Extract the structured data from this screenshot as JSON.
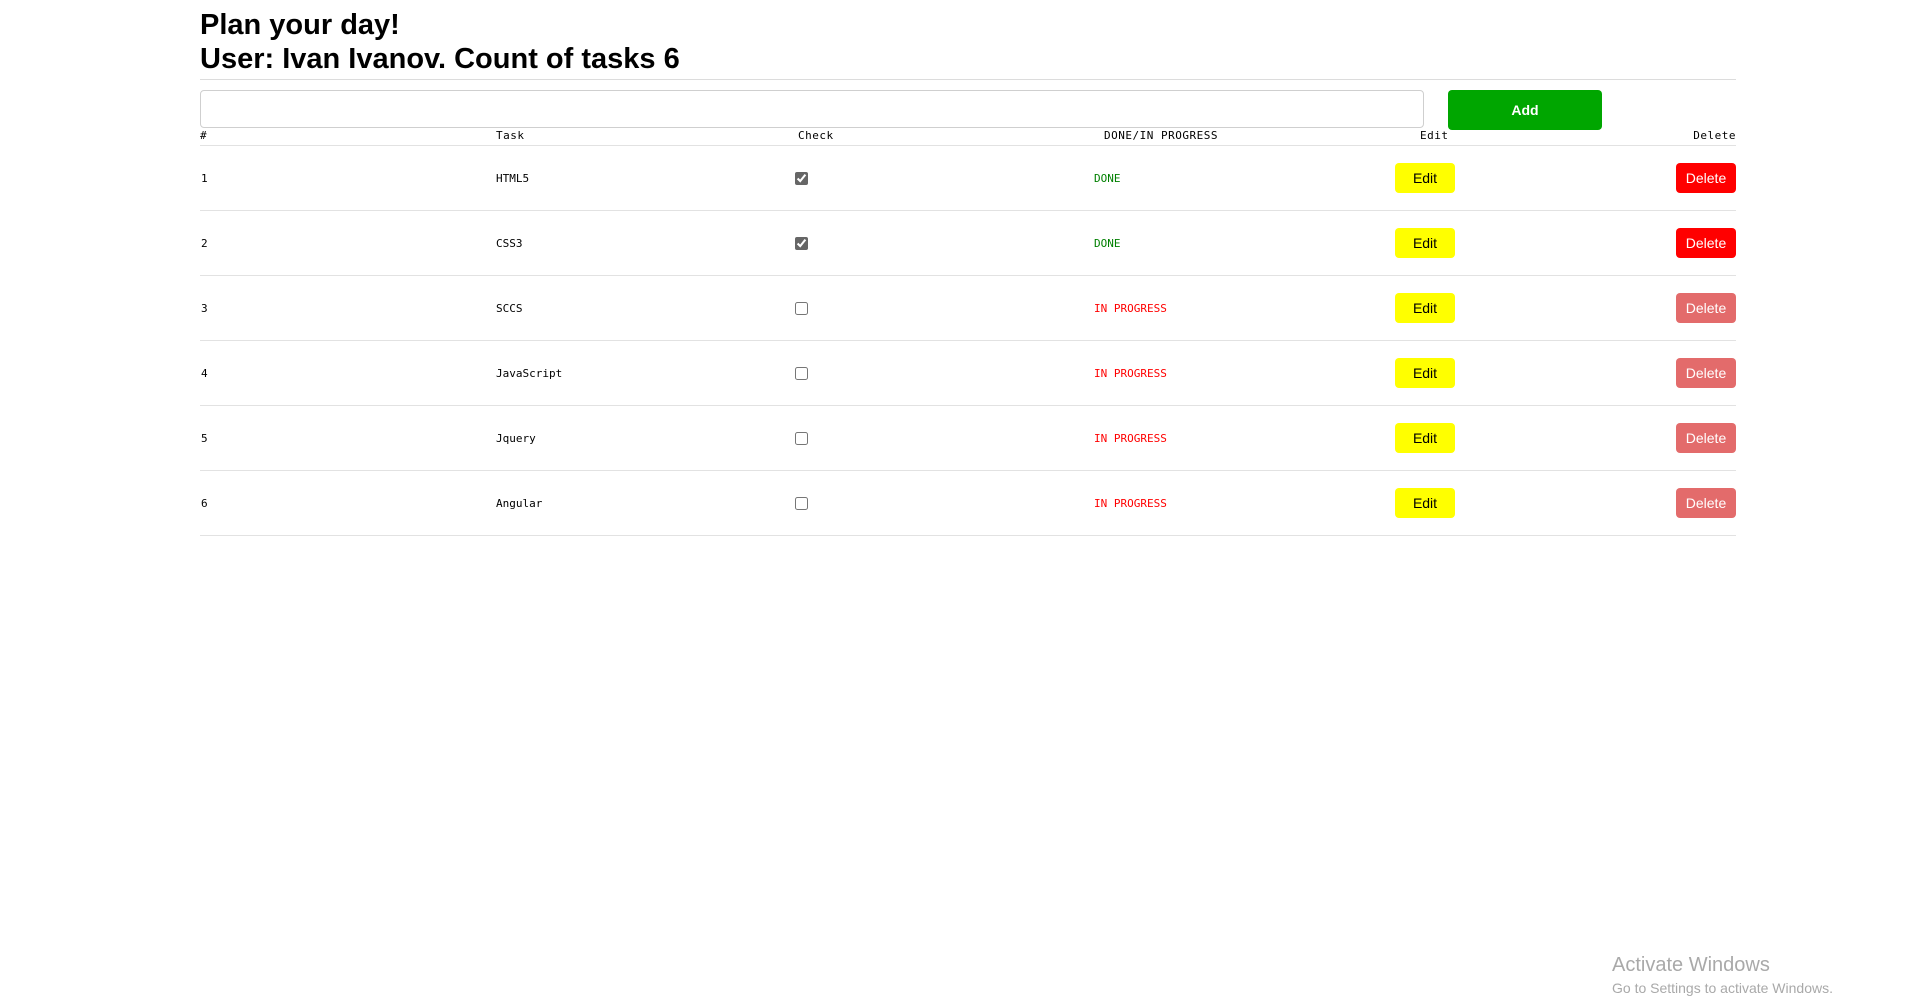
{
  "header": {
    "title_line1": "Plan your day!",
    "title_line2": "User: Ivan Ivanov. Count of tasks 6"
  },
  "add_form": {
    "input_value": "",
    "add_label": "Add"
  },
  "table": {
    "columns": {
      "num": "#",
      "task": "Task",
      "check": "Check",
      "status": "DONE/IN PROGRESS",
      "edit": "Edit",
      "delete": "Delete"
    },
    "rows": [
      {
        "num": "1",
        "task": "HTML5",
        "checked": true,
        "status": "DONE",
        "edit": "Edit",
        "delete": "Delete"
      },
      {
        "num": "2",
        "task": "CSS3",
        "checked": true,
        "status": "DONE",
        "edit": "Edit",
        "delete": "Delete"
      },
      {
        "num": "3",
        "task": "SCCS",
        "checked": false,
        "status": "IN PROGRESS",
        "edit": "Edit",
        "delete": "Delete"
      },
      {
        "num": "4",
        "task": "JavaScript",
        "checked": false,
        "status": "IN PROGRESS",
        "edit": "Edit",
        "delete": "Delete"
      },
      {
        "num": "5",
        "task": "Jquery",
        "checked": false,
        "status": "IN PROGRESS",
        "edit": "Edit",
        "delete": "Delete"
      },
      {
        "num": "6",
        "task": "Angular",
        "checked": false,
        "status": "IN PROGRESS",
        "edit": "Edit",
        "delete": "Delete"
      }
    ]
  },
  "watermark": {
    "title": "Activate Windows",
    "subtitle": "Go to Settings to activate Windows."
  },
  "colors": {
    "add_button": "#00a600",
    "edit_button": "#ffff00",
    "delete_active": "#ff0000",
    "delete_disabled": "#e36b6b",
    "status_done": "#008000",
    "status_in_progress": "#ff0000"
  }
}
